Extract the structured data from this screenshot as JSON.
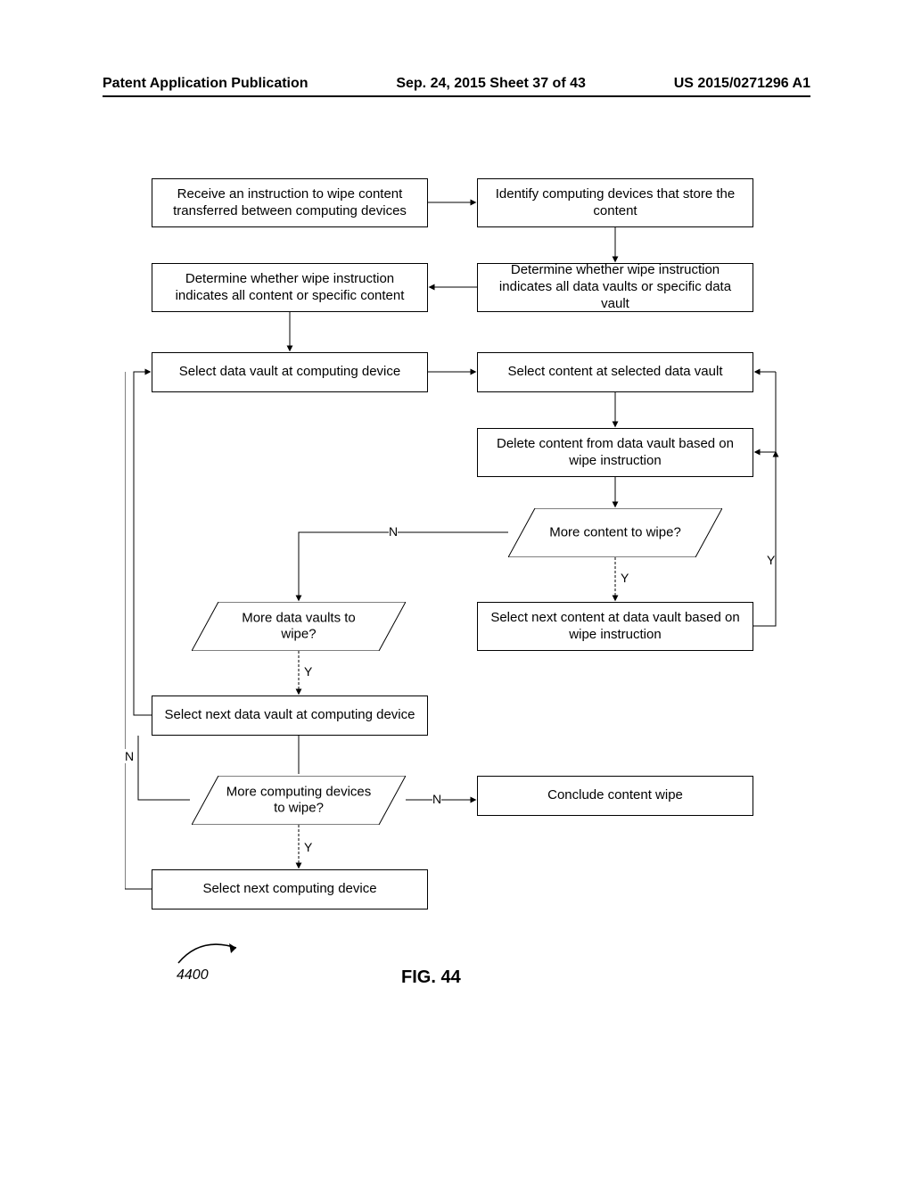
{
  "header": {
    "left": "Patent Application Publication",
    "mid": "Sep. 24, 2015  Sheet 37 of 43",
    "right": "US 2015/0271296 A1"
  },
  "nodes": {
    "n1": "Receive an instruction to wipe content transferred between computing devices",
    "n2": "Identify computing devices that store the content",
    "n3": "Determine whether wipe instruction indicates all content or specific content",
    "n4": "Determine whether wipe instruction indicates all data vaults or specific data vault",
    "n5": "Select data vault at computing device",
    "n6": "Select content at selected data vault",
    "n7": "Delete content from data vault based on wipe instruction",
    "d1": "More content to wipe?",
    "n8": "Select next content at data vault based on wipe instruction",
    "d2": "More data vaults to wipe?",
    "n9": "Select next data vault at computing device",
    "d3": "More computing devices to wipe?",
    "n10": "Conclude content wipe",
    "n11": "Select next computing device"
  },
  "labels": {
    "y": "Y",
    "n": "N"
  },
  "fig": {
    "num": "4400",
    "title": "FIG. 44"
  }
}
